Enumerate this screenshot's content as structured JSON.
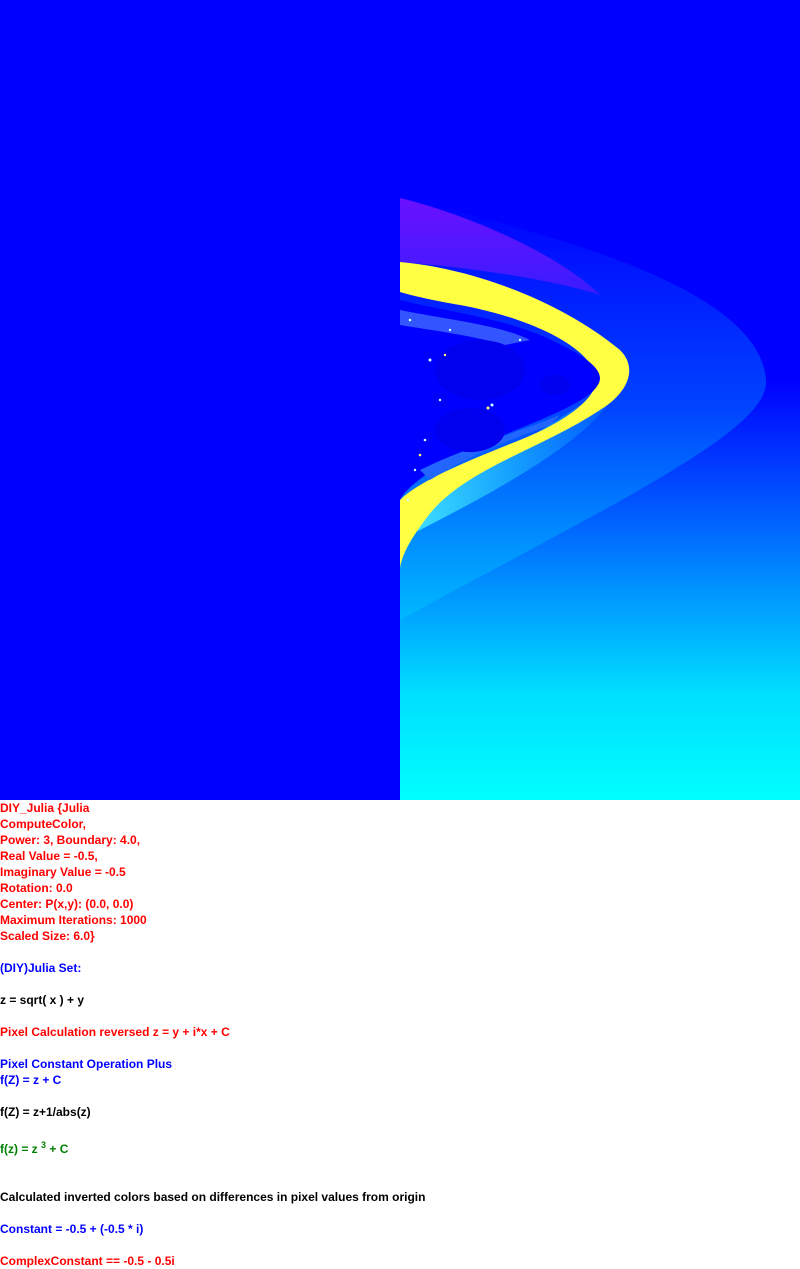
{
  "colors": {
    "background_blue": "#0000ff",
    "cyan": "#00ffff",
    "yellow": "#ffff44",
    "red_text": "#ff0000",
    "blue_text": "#0000ff",
    "green_text": "#008000",
    "black_text": "#000000"
  },
  "info": {
    "l1": "DIY_Julia {Julia",
    "l2": "ComputeColor,",
    "l3": "Power: 3, Boundary: 4.0,",
    "l4": "Real Value = -0.5,",
    "l5": "Imaginary Value = -0.5",
    "l6": "Rotation: 0.0",
    "l7": "Center: P(x,y): (0.0, 0.0)",
    "l8": "Maximum Iterations: 1000",
    "l9": "Scaled Size: 6.0}",
    "set_title": "(DIY)Julia Set:",
    "z_formula": "z = sqrt( x ) + y",
    "pixel_calc": "Pixel Calculation reversed z = y + i*x + C",
    "const_op": "Pixel Constant Operation Plus",
    "fz1": "f(Z) = z + C",
    "fz2": "f(Z) = z+1/abs(z)",
    "fz3_prefix": "f(z) = z ",
    "fz3_exp": "3",
    "fz3_suffix": " + C",
    "inverted": "Calculated inverted colors based on differences in pixel values from origin",
    "constant": "Constant = -0.5 + (-0.5 * i)",
    "complex_constant": "ComplexConstant == -0.5 - 0.5i"
  }
}
